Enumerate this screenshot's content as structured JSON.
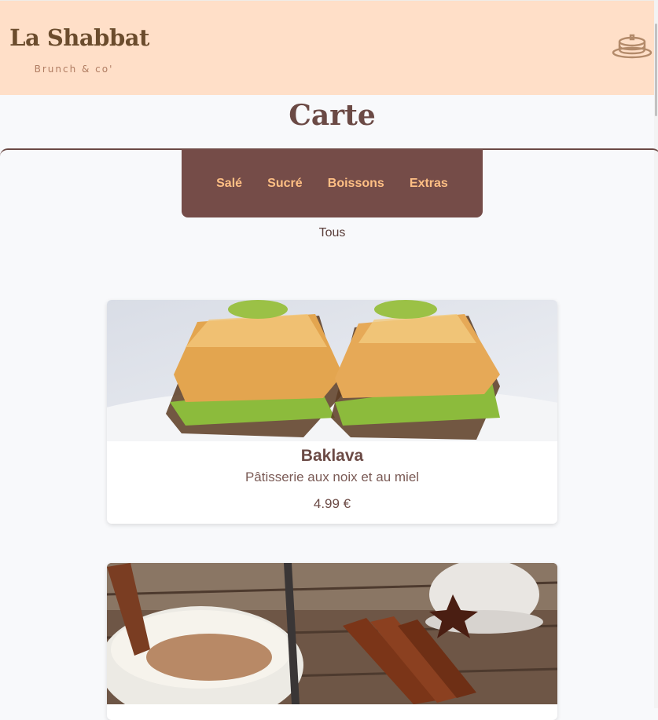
{
  "header": {
    "logo_title": "La Shabbat",
    "logo_subtitle": "Brunch & co'",
    "menu_icon": "pancake-icon"
  },
  "page": {
    "title": "Carte"
  },
  "categories": {
    "tabs": [
      "Salé",
      "Sucré",
      "Boissons",
      "Extras"
    ],
    "all_label": "Tous"
  },
  "products": [
    {
      "name": "Baklava",
      "description": "Pâtisserie aux noix et au miel",
      "price": "4.99 €",
      "image": "baklava-photo"
    },
    {
      "name": "",
      "description": "",
      "price": "",
      "image": "rice-pudding-cinnamon-photo"
    }
  ],
  "colors": {
    "header_bg": "#ffdfc8",
    "tabs_bg": "#754c48",
    "tab_text": "#ffbf84",
    "title_text": "#6b4a45"
  }
}
